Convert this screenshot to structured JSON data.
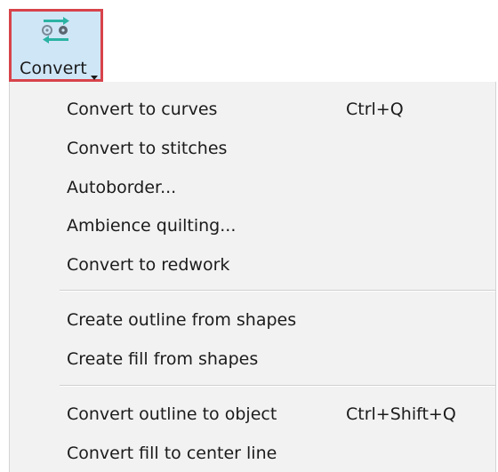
{
  "ribbon": {
    "button_label": "Convert",
    "icon": "convert-arrows-icon",
    "highlight_color": "#d8434b",
    "background_color": "#cfe6f7"
  },
  "menu": {
    "groups": [
      [
        {
          "label": "Convert to curves",
          "shortcut": "Ctrl+Q"
        },
        {
          "label": "Convert to stitches",
          "shortcut": ""
        },
        {
          "label": "Autoborder...",
          "shortcut": ""
        },
        {
          "label": "Ambience quilting...",
          "shortcut": ""
        },
        {
          "label": "Convert to redwork",
          "shortcut": ""
        }
      ],
      [
        {
          "label": "Create outline from shapes",
          "shortcut": ""
        },
        {
          "label": "Create fill from shapes",
          "shortcut": ""
        }
      ],
      [
        {
          "label": "Convert outline to object",
          "shortcut": "Ctrl+Shift+Q"
        },
        {
          "label": "Convert fill to center line",
          "shortcut": ""
        }
      ]
    ]
  }
}
